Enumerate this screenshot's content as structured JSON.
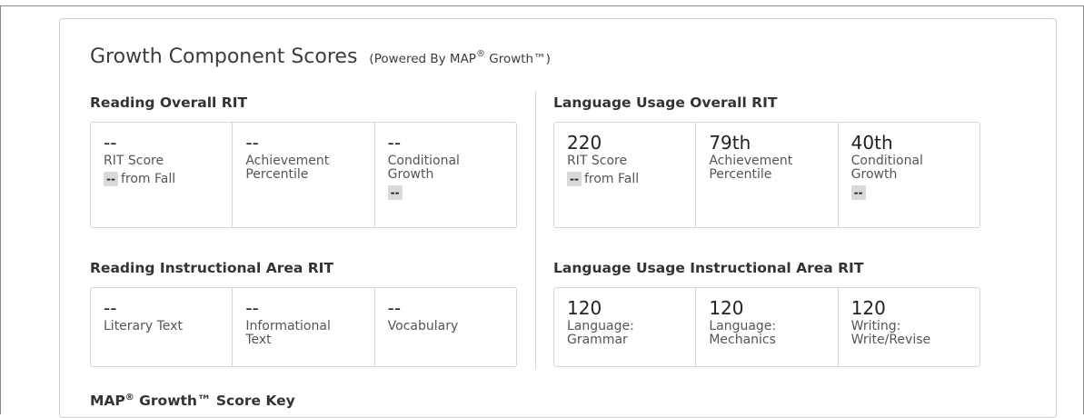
{
  "header": {
    "title": "Growth Component Scores",
    "subtitle_prefix": "(Powered By MAP",
    "subtitle_reg": "®",
    "subtitle_suffix": " Growth™)"
  },
  "reading_overall": {
    "heading": "Reading Overall RIT",
    "rit_value": "--",
    "rit_label": "RIT Score",
    "rit_change": "--",
    "rit_change_label": "from Fall",
    "achievement_value": "--",
    "achievement_label": "Achievement Percentile",
    "growth_value": "--",
    "growth_label": "Conditional Growth",
    "growth_badge": "--"
  },
  "language_overall": {
    "heading": "Language Usage Overall RIT",
    "rit_value": "220",
    "rit_label": "RIT Score",
    "rit_change": "--",
    "rit_change_label": "from Fall",
    "achievement_value": "79th",
    "achievement_label": "Achievement Percentile",
    "growth_value": "40th",
    "growth_label": "Conditional Growth",
    "growth_badge": "--"
  },
  "reading_instructional": {
    "heading": "Reading Instructional Area RIT",
    "areas": [
      {
        "value": "--",
        "label": "Literary Text"
      },
      {
        "value": "--",
        "label": "Informational Text"
      },
      {
        "value": "--",
        "label": "Vocabulary"
      }
    ]
  },
  "language_instructional": {
    "heading": "Language Usage Instructional Area RIT",
    "areas": [
      {
        "value": "120",
        "label": "Language: Grammar"
      },
      {
        "value": "120",
        "label": "Language: Mechanics"
      },
      {
        "value": "120",
        "label": "Writing: Write/Revise"
      }
    ]
  },
  "score_key": {
    "heading_prefix": "MAP",
    "heading_reg": "®",
    "heading_suffix": " Growth™ Score Key"
  }
}
